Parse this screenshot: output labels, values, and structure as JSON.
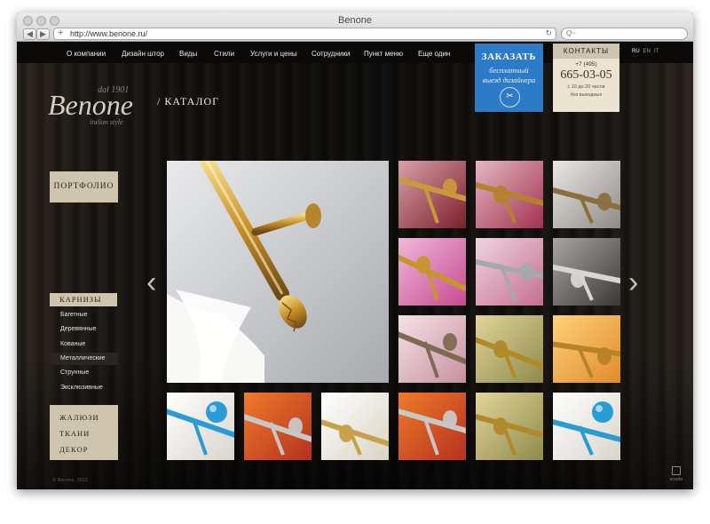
{
  "browser": {
    "title": "Benone",
    "url": "http://www.benone.ru/",
    "search_placeholder": "Q~"
  },
  "nav": {
    "items": [
      "О компании",
      "Дизайн штор",
      "Виды",
      "Стили",
      "Услуги и цены",
      "Сотрудники",
      "Пункт меню",
      "Еще один"
    ]
  },
  "order": {
    "title": "ЗАКАЗАТЬ",
    "line1": "бесплатный",
    "line2": "выезд дизайнера",
    "color": "#2d7ac7"
  },
  "contacts": {
    "title": "КОНТАКТЫ",
    "code": "+7 (495)",
    "phone": "665-03-05",
    "hours": "с 10 до 20 часов",
    "weekend": "без выходных"
  },
  "languages": [
    "RU",
    "EN",
    "IT"
  ],
  "logo": {
    "dal": "dal 1901",
    "name": "Benone",
    "tagline": "italian style"
  },
  "page_title": "/ КАТАЛОГ",
  "sidebar": {
    "portfolio": "ПОРТФОЛИО",
    "category": "КАРНИЗЫ",
    "subitems": [
      "Багетные",
      "Деревянные",
      "Кованые",
      "Металлические",
      "Струнные",
      "Эксклюзивные"
    ],
    "active_index": 3,
    "bottom": [
      "ЖАЛЮЗИ",
      "ТКАНИ",
      "ДЕКОР"
    ]
  },
  "gallery": {
    "main_image": "curtain-rod-gold-large",
    "thumbs": [
      "curtain-rod-red",
      "curtain-rod-pink-cone",
      "curtain-rod-bronze-grey",
      "curtain-rod-pink-gold",
      "curtain-rod-pink-silver",
      "curtain-rod-chrome-pattern",
      "curtain-rod-ornate-bronze",
      "curtain-rod-gold-green",
      "curtain-rod-orange-gold",
      "curtain-rod-blue-ball",
      "curtain-rod-orange-candle",
      "curtain-rod-gold-trumpet",
      "curtain-rod-orange-candle-2",
      "curtain-rod-gold-green-2",
      "curtain-rod-blue-ball-2"
    ]
  },
  "footer": {
    "copyright": "© Benone, 2013",
    "brand": "scada"
  }
}
